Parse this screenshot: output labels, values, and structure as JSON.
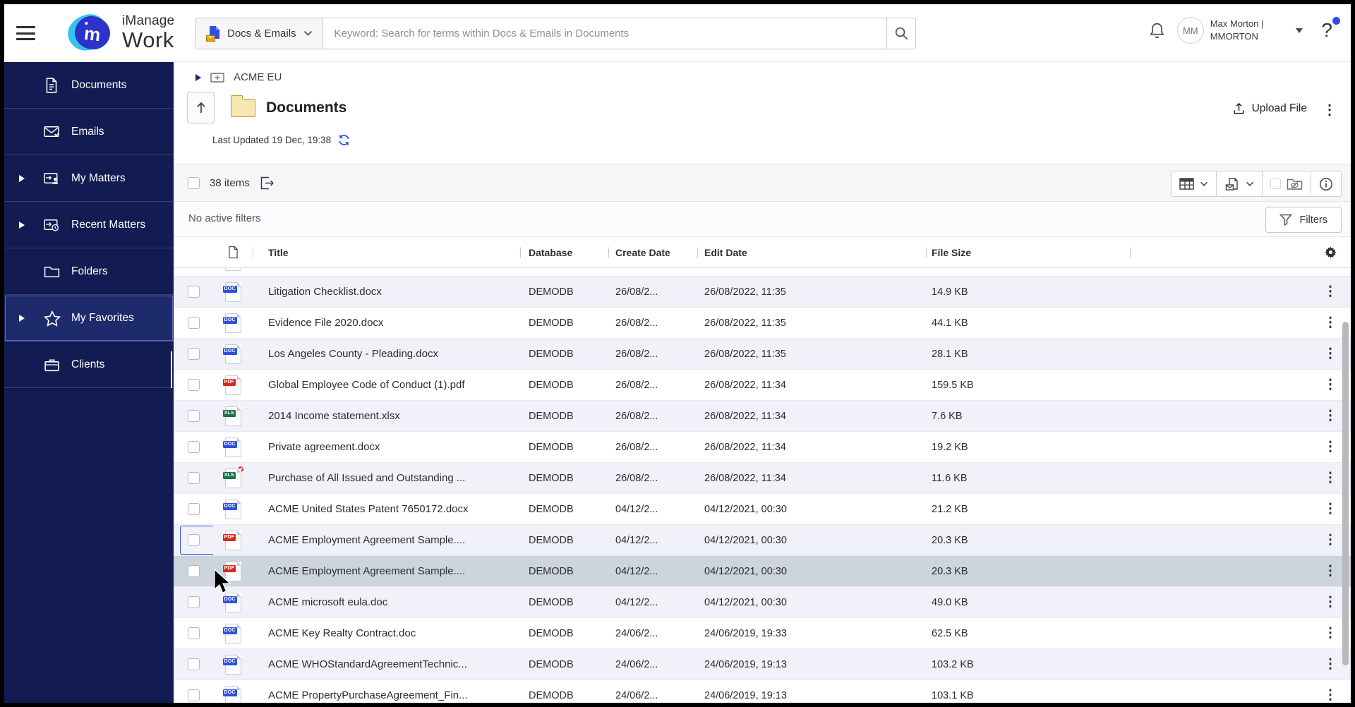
{
  "topbar": {
    "logo": {
      "line1": "iManage",
      "line2": "Work",
      "monogram": "m"
    },
    "scope": {
      "label": "Docs & Emails"
    },
    "search": {
      "placeholder": "Keyword: Search for terms within Docs & Emails in Documents"
    },
    "user": {
      "initials": "MM",
      "name": "Max Morton |",
      "id": "MMORTON"
    },
    "help_glyph": "?"
  },
  "sidebar": {
    "items": [
      {
        "label": "Documents",
        "icon": "document-icon",
        "expandable": false,
        "selected": false
      },
      {
        "label": "Emails",
        "icon": "email-icon",
        "expandable": false,
        "selected": false
      },
      {
        "label": "My Matters",
        "icon": "matter-icon",
        "expandable": true,
        "selected": false
      },
      {
        "label": "Recent Matters",
        "icon": "recent-matter-icon",
        "expandable": true,
        "selected": false
      },
      {
        "label": "Folders",
        "icon": "folder-icon",
        "expandable": false,
        "selected": false
      },
      {
        "label": "My Favorites",
        "icon": "star-icon",
        "expandable": true,
        "selected": true
      },
      {
        "label": "Clients",
        "icon": "briefcase-icon",
        "expandable": false,
        "selected": false
      }
    ]
  },
  "content_header": {
    "breadcrumb": "ACME EU",
    "title": "Documents",
    "last_updated": "Last Updated 19 Dec, 19:38",
    "upload_label": "Upload File"
  },
  "toolbar": {
    "items_count": "38 items"
  },
  "filter_bar": {
    "status": "No active filters",
    "button_label": "Filters"
  },
  "table": {
    "headers": {
      "title": "Title",
      "database": "Database",
      "create_date": "Create Date",
      "edit_date": "Edit Date",
      "file_size": "File Size"
    },
    "partial_row_visible": true,
    "rows": [
      {
        "type": "doc",
        "title": "Litigation Checklist.docx",
        "database": "DEMODB",
        "create_date": "26/08/2...",
        "edit_date": "26/08/2022, 11:35",
        "file_size": "14.9 KB",
        "shade": "alt",
        "restricted": false,
        "checkbox_focused": false
      },
      {
        "type": "doc",
        "title": "Evidence File 2020.docx",
        "database": "DEMODB",
        "create_date": "26/08/2...",
        "edit_date": "26/08/2022, 11:35",
        "file_size": "44.1 KB",
        "shade": "base",
        "restricted": false,
        "checkbox_focused": false
      },
      {
        "type": "doc",
        "title": "Los Angeles County - Pleading.docx",
        "database": "DEMODB",
        "create_date": "26/08/2...",
        "edit_date": "26/08/2022, 11:35",
        "file_size": "28.1 KB",
        "shade": "alt",
        "restricted": false,
        "checkbox_focused": false
      },
      {
        "type": "pdf",
        "title": "Global Employee Code of Conduct (1).pdf",
        "database": "DEMODB",
        "create_date": "26/08/2...",
        "edit_date": "26/08/2022, 11:34",
        "file_size": "159.5 KB",
        "shade": "base",
        "restricted": false,
        "checkbox_focused": false
      },
      {
        "type": "xls",
        "title": "2014 Income statement.xlsx",
        "database": "DEMODB",
        "create_date": "26/08/2...",
        "edit_date": "26/08/2022, 11:34",
        "file_size": "7.6 KB",
        "shade": "alt",
        "restricted": false,
        "checkbox_focused": false
      },
      {
        "type": "doc",
        "title": "Private agreement.docx",
        "database": "DEMODB",
        "create_date": "26/08/2...",
        "edit_date": "26/08/2022, 11:34",
        "file_size": "19.2 KB",
        "shade": "base",
        "restricted": false,
        "checkbox_focused": false
      },
      {
        "type": "xls",
        "title": "Purchase of All Issued and Outstanding ...",
        "database": "DEMODB",
        "create_date": "26/08/2...",
        "edit_date": "26/08/2022, 11:34",
        "file_size": "11.6 KB",
        "shade": "alt",
        "restricted": true,
        "checkbox_focused": false
      },
      {
        "type": "doc",
        "title": "ACME United States Patent 7650172.docx",
        "database": "DEMODB",
        "create_date": "04/12/2...",
        "edit_date": "04/12/2021, 00:30",
        "file_size": "21.2 KB",
        "shade": "base",
        "restricted": false,
        "checkbox_focused": false
      },
      {
        "type": "pdf",
        "title": "ACME Employment Agreement Sample....",
        "database": "DEMODB",
        "create_date": "04/12/2...",
        "edit_date": "04/12/2021, 00:30",
        "file_size": "20.3 KB",
        "shade": "alt",
        "restricted": false,
        "checkbox_focused": true
      },
      {
        "type": "pdf",
        "title": "ACME Employment Agreement Sample....",
        "database": "DEMODB",
        "create_date": "04/12/2...",
        "edit_date": "04/12/2021, 00:30",
        "file_size": "20.3 KB",
        "shade": "hover",
        "restricted": false,
        "checkbox_focused": false
      },
      {
        "type": "doc",
        "title": "ACME microsoft eula.doc",
        "database": "DEMODB",
        "create_date": "04/12/2...",
        "edit_date": "04/12/2021, 00:30",
        "file_size": "49.0 KB",
        "shade": "alt",
        "restricted": false,
        "checkbox_focused": false
      },
      {
        "type": "doc",
        "title": "ACME Key Realty Contract.doc",
        "database": "DEMODB",
        "create_date": "24/06/2...",
        "edit_date": "24/06/2019, 19:33",
        "file_size": "62.5 KB",
        "shade": "base",
        "restricted": false,
        "checkbox_focused": false
      },
      {
        "type": "doc",
        "title": "ACME WHOStandardAgreementTechnic...",
        "database": "DEMODB",
        "create_date": "24/06/2...",
        "edit_date": "24/06/2019, 19:13",
        "file_size": "103.2 KB",
        "shade": "alt",
        "restricted": false,
        "checkbox_focused": false
      },
      {
        "type": "doc",
        "title": "ACME PropertyPurchaseAgreement_Fin...",
        "database": "DEMODB",
        "create_date": "24/06/2...",
        "edit_date": "24/06/2019, 19:13",
        "file_size": "103.1 KB",
        "shade": "base",
        "restricted": false,
        "checkbox_focused": false
      }
    ]
  },
  "file_types": {
    "doc": {
      "label": "DOC",
      "color": "#2b50e2"
    },
    "pdf": {
      "label": "PDF",
      "color": "#d8281f"
    },
    "xls": {
      "label": "XLS",
      "color": "#1e7145"
    }
  },
  "colors": {
    "accent_blue": "#2b50e2",
    "sidebar_navy": "#121c52",
    "row_alt": "#f1f1fa",
    "row_hover": "#ccd5db"
  }
}
